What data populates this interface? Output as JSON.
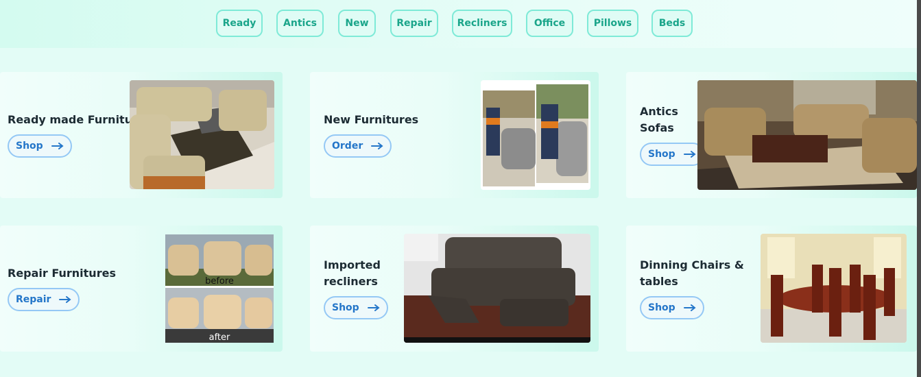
{
  "nav": {
    "pills": [
      "Ready",
      "Antics",
      "New",
      "Repair",
      "Recliners",
      "Office",
      "Pillows",
      "Beds"
    ]
  },
  "cards": [
    {
      "title": "Ready made Furnitures",
      "button": "Shop",
      "image": "sofa-set-image"
    },
    {
      "title": "New Furnitures",
      "button": "Order",
      "image": "workers-upholstering-image"
    },
    {
      "title_line1": "Antics",
      "title_line2": "Sofas",
      "button": "Shop",
      "image": "antique-sofas-image"
    },
    {
      "title": "Repair Furnitures",
      "button": "Repair",
      "image": "before-after-image",
      "caption_before": "before",
      "caption_after": "after"
    },
    {
      "title_line1": "Imported",
      "title_line2": "recliners",
      "button": "Shop",
      "image": "recliner-sofa-image"
    },
    {
      "title_line1": "Dinning Chairs &",
      "title_line2": "tables",
      "button": "Shop",
      "image": "dining-set-image"
    }
  ],
  "icons": {
    "button_arrow": "arrow-right-icon"
  },
  "colors": {
    "pill_border": "#7eead7",
    "pill_text": "#1aa58a",
    "button_border": "#94c8f5",
    "button_text": "#2476c9",
    "title_text": "#1c2b33"
  }
}
